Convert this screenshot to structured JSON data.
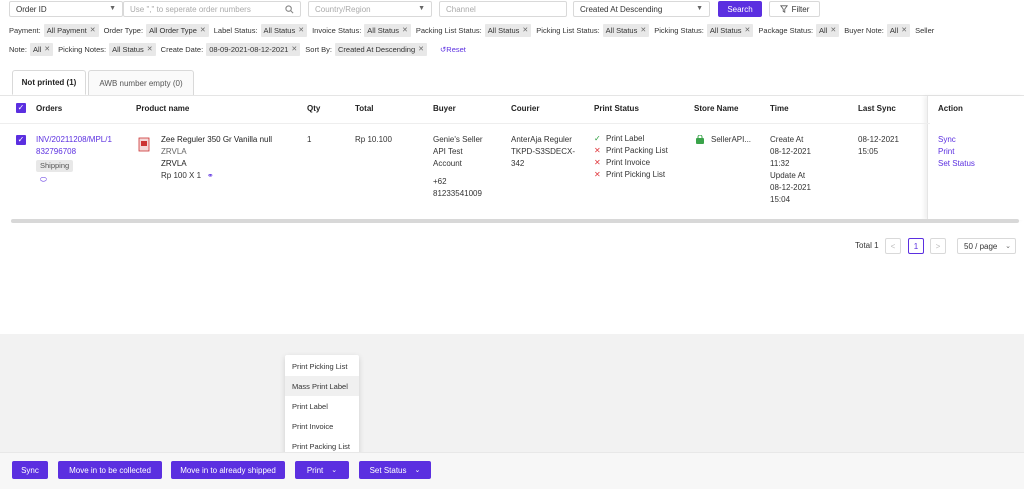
{
  "search": {
    "field_select": "Order ID",
    "order_input_placeholder": "Use \",\" to seperate order numbers",
    "country_placeholder": "Country/Region",
    "channel_placeholder": "Channel",
    "sort_select": "Created At Descending",
    "search_label": "Search",
    "filter_label": "Filter"
  },
  "filters": {
    "row1": [
      {
        "label": "Payment:",
        "value": "All Payment"
      },
      {
        "label": "Order Type:",
        "value": "All Order Type"
      },
      {
        "label": "Label Status:",
        "value": "All Status"
      },
      {
        "label": "Invoice Status:",
        "value": "All Status"
      },
      {
        "label": "Packing List Status:",
        "value": "All Status"
      },
      {
        "label": "Picking List Status:",
        "value": "All Status"
      },
      {
        "label": "Picking Status:",
        "value": "All Status"
      },
      {
        "label": "Package Status:",
        "value": "All"
      },
      {
        "label": "Buyer Note:",
        "value": "All"
      }
    ],
    "row1_trailing": "Seller",
    "row2": [
      {
        "label": "Note:",
        "value": "All"
      },
      {
        "label": "Picking Notes:",
        "value": "All Status"
      },
      {
        "label": "Create Date:",
        "value": "08-09-2021-08-12-2021"
      },
      {
        "label": "Sort By:",
        "value": "Created At Descending"
      }
    ],
    "reset_label": "Reset"
  },
  "tabs": [
    {
      "label": "Not printed (1)"
    },
    {
      "label": "AWB number empty (0)"
    }
  ],
  "table": {
    "headers": {
      "orders": "Orders",
      "product": "Product name",
      "qty": "Qty",
      "total": "Total",
      "buyer": "Buyer",
      "courier": "Courier",
      "print_status": "Print Status",
      "store": "Store Name",
      "time": "Time",
      "last_sync": "Last Sync",
      "action": "Action"
    },
    "row": {
      "order_line1": "INV/20211208/MPL/1",
      "order_line2": "832796708",
      "order_badge": "Shipping",
      "product_name": "Zee Reguler 350 Gr Vanilla null",
      "product_sku1": "ZRVLA",
      "product_sku2": "ZRVLA",
      "product_price": "Rp 100 X 1",
      "qty": "1",
      "total": "Rp 10.100",
      "buyer_line1": "Genie's Seller",
      "buyer_line2": "API Test",
      "buyer_line3": "Account",
      "buyer_phone1": "+62",
      "buyer_phone2": "81233541009",
      "courier_line1": "AnterAja Reguler",
      "courier_line2": "TKPD-S3SDECX-",
      "courier_line3": "342",
      "print_status": [
        {
          "mark": "✓",
          "label": "Print Label"
        },
        {
          "mark": "✕",
          "label": "Print Packing List"
        },
        {
          "mark": "✕",
          "label": "Print Invoice"
        },
        {
          "mark": "✕",
          "label": "Print Picking List"
        }
      ],
      "store": "SellerAPI...",
      "time_lines": [
        "Create At",
        "08-12-2021",
        "11:32",
        "Update At",
        "08-12-2021",
        "15:04"
      ],
      "last_sync_date": "08-12-2021",
      "last_sync_time": "15:05",
      "actions": [
        "Sync",
        "Print",
        "Set Status"
      ]
    }
  },
  "pagination": {
    "total_label": "Total 1",
    "prev": "<",
    "current": "1",
    "next": ">",
    "page_size": "50 / page"
  },
  "print_menu": [
    "Print Picking List",
    "Mass Print Label",
    "Print Label",
    "Print Invoice",
    "Print Packing List"
  ],
  "bottom_actions": {
    "sync": "Sync",
    "move_collected": "Move in to be collected",
    "move_shipped": "Move in to already shipped",
    "print": "Print",
    "set_status": "Set Status"
  },
  "colors": {
    "primary": "#5b2fe0",
    "success": "#2a9d3c",
    "danger": "#e0393e"
  }
}
